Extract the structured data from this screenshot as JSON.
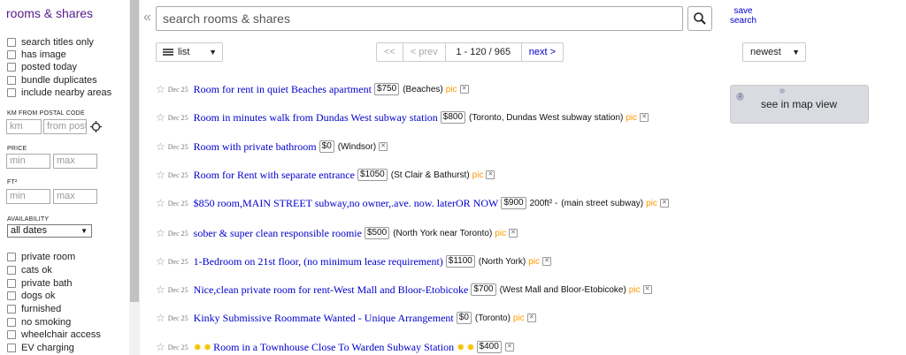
{
  "sidebar": {
    "title": "rooms & shares",
    "options": [
      "search titles only",
      "has image",
      "posted today",
      "bundle duplicates",
      "include nearby areas"
    ],
    "postal_label": "KM FROM POSTAL CODE",
    "km_placeholder": "km",
    "postal_placeholder": "from postal",
    "price_label": "PRICE",
    "price_min_placeholder": "min",
    "price_max_placeholder": "max",
    "ft_label": "FT²",
    "ft_min_placeholder": "min",
    "ft_max_placeholder": "max",
    "availability_label": "AVAILABILITY",
    "availability_value": "all dates",
    "filters": [
      "private room",
      "cats ok",
      "private bath",
      "dogs ok",
      "furnished",
      "no smoking",
      "wheelchair access",
      "EV charging"
    ]
  },
  "search": {
    "collapse": "«",
    "placeholder": "search rooms & shares",
    "save_line1": "save",
    "save_line2": "search"
  },
  "toolbar": {
    "view": "list",
    "pager": {
      "first": "<<",
      "prev": "< prev",
      "range": "1 - 120 / 965",
      "next": "next >"
    },
    "sort": "newest"
  },
  "map": {
    "label": "see in map view"
  },
  "listings": [
    {
      "date": "Dec 25",
      "title": "Room for rent in quiet Beaches apartment",
      "price": "$750",
      "extra": "",
      "hood": "(Beaches)",
      "pic": "pic",
      "sun": false
    },
    {
      "date": "Dec 25",
      "title": "Room in minutes walk from Dundas West subway station",
      "price": "$800",
      "extra": "",
      "hood": "(Toronto, Dundas West subway station)",
      "pic": "pic",
      "sun": false
    },
    {
      "date": "Dec 25",
      "title": "Room with private bathroom",
      "price": "$0",
      "extra": "",
      "hood": "(Windsor)",
      "pic": "",
      "sun": false
    },
    {
      "date": "Dec 25",
      "title": "Room for Rent with separate entrance",
      "price": "$1050",
      "extra": "",
      "hood": "(St Clair & Bathurst)",
      "pic": "pic",
      "sun": false
    },
    {
      "date": "Dec 25",
      "title": "$850 room,MAIN STREET subway,no owner,.ave. now. laterOR NOW",
      "price": "$900",
      "extra": "200ft² -",
      "hood": "(main street subway)",
      "pic": "pic",
      "sun": false
    },
    {
      "date": "Dec 25",
      "title": "sober & super clean responsible roomie",
      "price": "$500",
      "extra": "",
      "hood": "(North York near Toronto)",
      "pic": "pic",
      "sun": false
    },
    {
      "date": "Dec 25",
      "title": "1-Bedroom on 21st floor, (no minimum lease requirement)",
      "price": "$1100",
      "extra": "",
      "hood": "(North York)",
      "pic": "pic",
      "sun": false
    },
    {
      "date": "Dec 25",
      "title": "Nice,clean private room for rent-West Mall and Bloor-Etobicoke",
      "price": "$700",
      "extra": "",
      "hood": "(West Mall and Bloor-Etobicoke)",
      "pic": "pic",
      "sun": false
    },
    {
      "date": "Dec 25",
      "title": "Kinky Submissive Roommate Wanted - Unique Arrangement",
      "price": "$0",
      "extra": "",
      "hood": "(Toronto)",
      "pic": "pic",
      "sun": false
    },
    {
      "date": "Dec 25",
      "title": "Room in a Townhouse Close To Warden Subway Station",
      "price": "$400",
      "extra": "",
      "hood": "",
      "pic": "",
      "sun": true
    }
  ],
  "colors": {
    "link": "#0000cc",
    "title_purple": "#551a8b",
    "pic_orange": "#ff9900"
  }
}
